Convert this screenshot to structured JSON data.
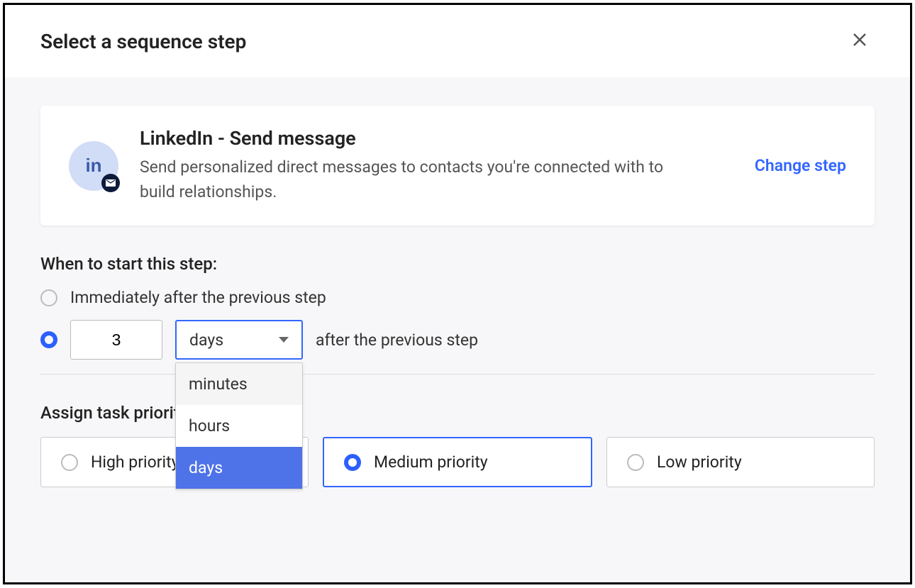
{
  "modal": {
    "title": "Select a sequence step"
  },
  "step": {
    "icon_text": "in",
    "title": "LinkedIn - Send message",
    "description": "Send personalized direct messages to contacts you're connected with to build relationships.",
    "change_link": "Change step"
  },
  "timing": {
    "section_label": "When to start this step:",
    "option_immediate": "Immediately after the previous step",
    "delay_value": "3",
    "unit_selected": "days",
    "unit_options": {
      "minutes": "minutes",
      "hours": "hours",
      "days": "days"
    },
    "after_text": "after the previous step"
  },
  "priority": {
    "section_label": "Assign task priority:",
    "high": "High priority",
    "medium": "Medium priority",
    "low": "Low priority"
  }
}
